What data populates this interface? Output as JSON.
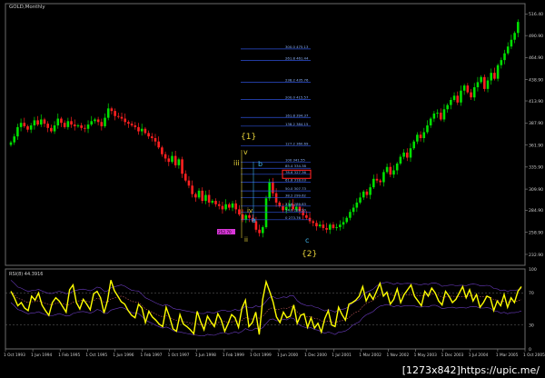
{
  "chart_title": "GOLD,Monthly",
  "oscillator_label": "RSI(8) 44.3916",
  "watermark": "[1273x842]https://upic.me/",
  "colors": {
    "bg": "#000000",
    "up": "#00e000",
    "down": "#ff2020",
    "fib": "#2d4fd6",
    "rsi": "#ffff00",
    "rsi_band": "#6a3bbf",
    "elliott_main": "#e6d23a",
    "elliott_sub": "#3fb0e6",
    "box": "#ff2020",
    "magenta": "#ff40ff"
  },
  "x_labels": [
    "1 Oct 1993",
    "1 Jun 1994",
    "1 Feb 1995",
    "1 Oct 1995",
    "1 Jun 1996",
    "1 Feb 1997",
    "1 Oct 1997",
    "1 Jun 1998",
    "1 Feb 1999",
    "1 Oct 1999",
    "1 Jun 2000",
    "1 Dec 2000",
    "1 Jul 2001",
    "1 Mar 2002",
    "1 Nov 2002",
    "1 May 2003",
    "1 Dec 2003",
    "1 Jul 2004",
    "1 Mar 2005",
    "1 Oct 2005"
  ],
  "y_labels": [
    "516.40",
    "490.90",
    "464.90",
    "438.90",
    "413.90",
    "387.90",
    "361.90",
    "335.90",
    "309.90",
    "284.90",
    "258.90",
    "232.90"
  ],
  "rsi_labels": [
    "100",
    "70",
    "30",
    "0"
  ],
  "fib_levels": [
    {
      "label": "300.0 475.13"
    },
    {
      "label": "261.8 461.44"
    },
    {
      "label": "238.2 435.76"
    },
    {
      "label": "200.0 415.57"
    },
    {
      "label": "161.8 394.37"
    },
    {
      "label": "138.2 384.15"
    },
    {
      "label": "127.2 360.69"
    },
    {
      "label": "100 341.55"
    },
    {
      "label": "85.4 334.38"
    },
    {
      "label": "78.6 327.36"
    },
    {
      "label": "61.8 318.03"
    },
    {
      "label": "50.0 307.73"
    },
    {
      "label": "38.2 299.62"
    },
    {
      "label": "23.6 289.83"
    },
    {
      "label": "14.6 282.90"
    },
    {
      "label": "0 273.76"
    }
  ],
  "elliott": {
    "wave1": "{1}",
    "wave2": "{2}",
    "iii": "iii",
    "v": "v",
    "b": "b",
    "iv": "iv",
    "a": "a",
    "ii": "ii",
    "c": "c",
    "low_box": "252.70"
  },
  "chart_data": [
    {
      "type": "bar",
      "title": "GOLD,Monthly",
      "x_range": [
        "1 Oct 1993",
        "1 Oct 2005"
      ],
      "ylim": [
        220,
        520
      ],
      "y_ticks": [
        516.4,
        490.9,
        464.9,
        438.9,
        413.9,
        387.9,
        361.9,
        335.9,
        309.9,
        284.9,
        258.9,
        232.9
      ],
      "close_series": [
        365,
        372,
        383,
        388,
        384,
        380,
        385,
        391,
        386,
        392,
        387,
        382,
        378,
        385,
        393,
        388,
        383,
        390,
        386,
        384,
        385,
        382,
        381,
        386,
        390,
        392,
        389,
        384,
        394,
        405,
        402,
        396,
        395,
        393,
        389,
        387,
        385,
        383,
        378,
        381,
        376,
        372,
        370,
        366,
        359,
        351,
        346,
        342,
        349,
        338,
        345,
        328,
        320,
        314,
        304,
        300,
        308,
        296,
        303,
        294,
        296,
        292,
        290,
        286,
        292,
        288,
        293,
        286,
        280,
        274,
        279,
        276,
        272,
        262,
        258,
        265,
        299,
        318,
        305,
        294,
        290,
        285,
        289,
        292,
        286,
        289,
        284,
        279,
        276,
        272,
        270,
        266,
        268,
        264,
        262,
        268,
        264,
        265,
        268,
        271,
        276,
        283,
        288,
        294,
        300,
        307,
        303,
        312,
        322,
        320,
        318,
        330,
        336,
        327,
        332,
        340,
        348,
        353,
        347,
        358,
        366,
        374,
        370,
        377,
        385,
        393,
        399,
        400,
        392,
        404,
        409,
        415,
        420,
        412,
        426,
        432,
        424,
        418,
        430,
        436,
        442,
        428,
        438,
        447,
        440,
        456,
        462,
        470,
        478,
        486,
        494,
        507
      ]
    },
    {
      "type": "line",
      "title": "RSI(8) 44.3916",
      "ylim": [
        0,
        100
      ],
      "y_ticks": [
        100,
        70,
        30,
        0
      ],
      "rsi_series": [
        72,
        64,
        54,
        58,
        51,
        48,
        66,
        61,
        70,
        55,
        48,
        42,
        58,
        64,
        60,
        53,
        46,
        74,
        80,
        58,
        50,
        62,
        56,
        49,
        69,
        72,
        64,
        45,
        60,
        86,
        73,
        66,
        59,
        56,
        48,
        42,
        39,
        56,
        51,
        33,
        47,
        40,
        36,
        31,
        28,
        52,
        40,
        25,
        22,
        43,
        31,
        28,
        24,
        19,
        47,
        34,
        24,
        41,
        34,
        28,
        44,
        36,
        22,
        32,
        43,
        39,
        27,
        51,
        61,
        28,
        33,
        46,
        18,
        62,
        84,
        72,
        59,
        40,
        33,
        46,
        39,
        41,
        55,
        32,
        42,
        44,
        27,
        39,
        26,
        32,
        21,
        38,
        48,
        30,
        28,
        52,
        43,
        36,
        56,
        58,
        61,
        66,
        78,
        60,
        69,
        62,
        72,
        82,
        66,
        71,
        56,
        62,
        75,
        58,
        68,
        74,
        80,
        66,
        60,
        54,
        72,
        66,
        76,
        70,
        60,
        55,
        72,
        66,
        58,
        62,
        70,
        78,
        64,
        74,
        60,
        68,
        52,
        58,
        66,
        64,
        48,
        60,
        54,
        68,
        52,
        64,
        58,
        72,
        78
      ]
    }
  ]
}
